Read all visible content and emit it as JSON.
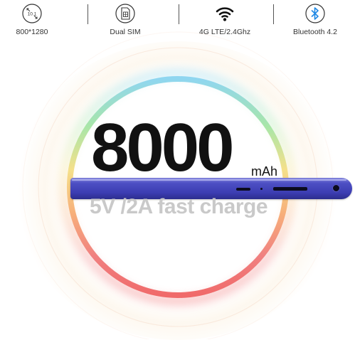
{
  "specs": [
    {
      "label": "800*1280",
      "icon": "screen-size-icon",
      "icon_text": "10.1"
    },
    {
      "label": "Dual SIM",
      "icon": "sim-card-icon"
    },
    {
      "label": "4G LTE/2.4Ghz",
      "icon": "wifi-icon"
    },
    {
      "label": "Bluetooth 4.2",
      "icon": "bluetooth-icon",
      "icon_color": "#1e88e5"
    }
  ],
  "battery": {
    "capacity": "8000",
    "unit": "mAh",
    "charging": "5V /2A fast charge"
  },
  "colors": {
    "tablet_body": "#3c3db2",
    "charge_text": "#c9c9c9",
    "ring": [
      "#8fd6f0",
      "#a8e6a8",
      "#f5e08a",
      "#f7b07a",
      "#f08080",
      "#f06a6a"
    ]
  }
}
